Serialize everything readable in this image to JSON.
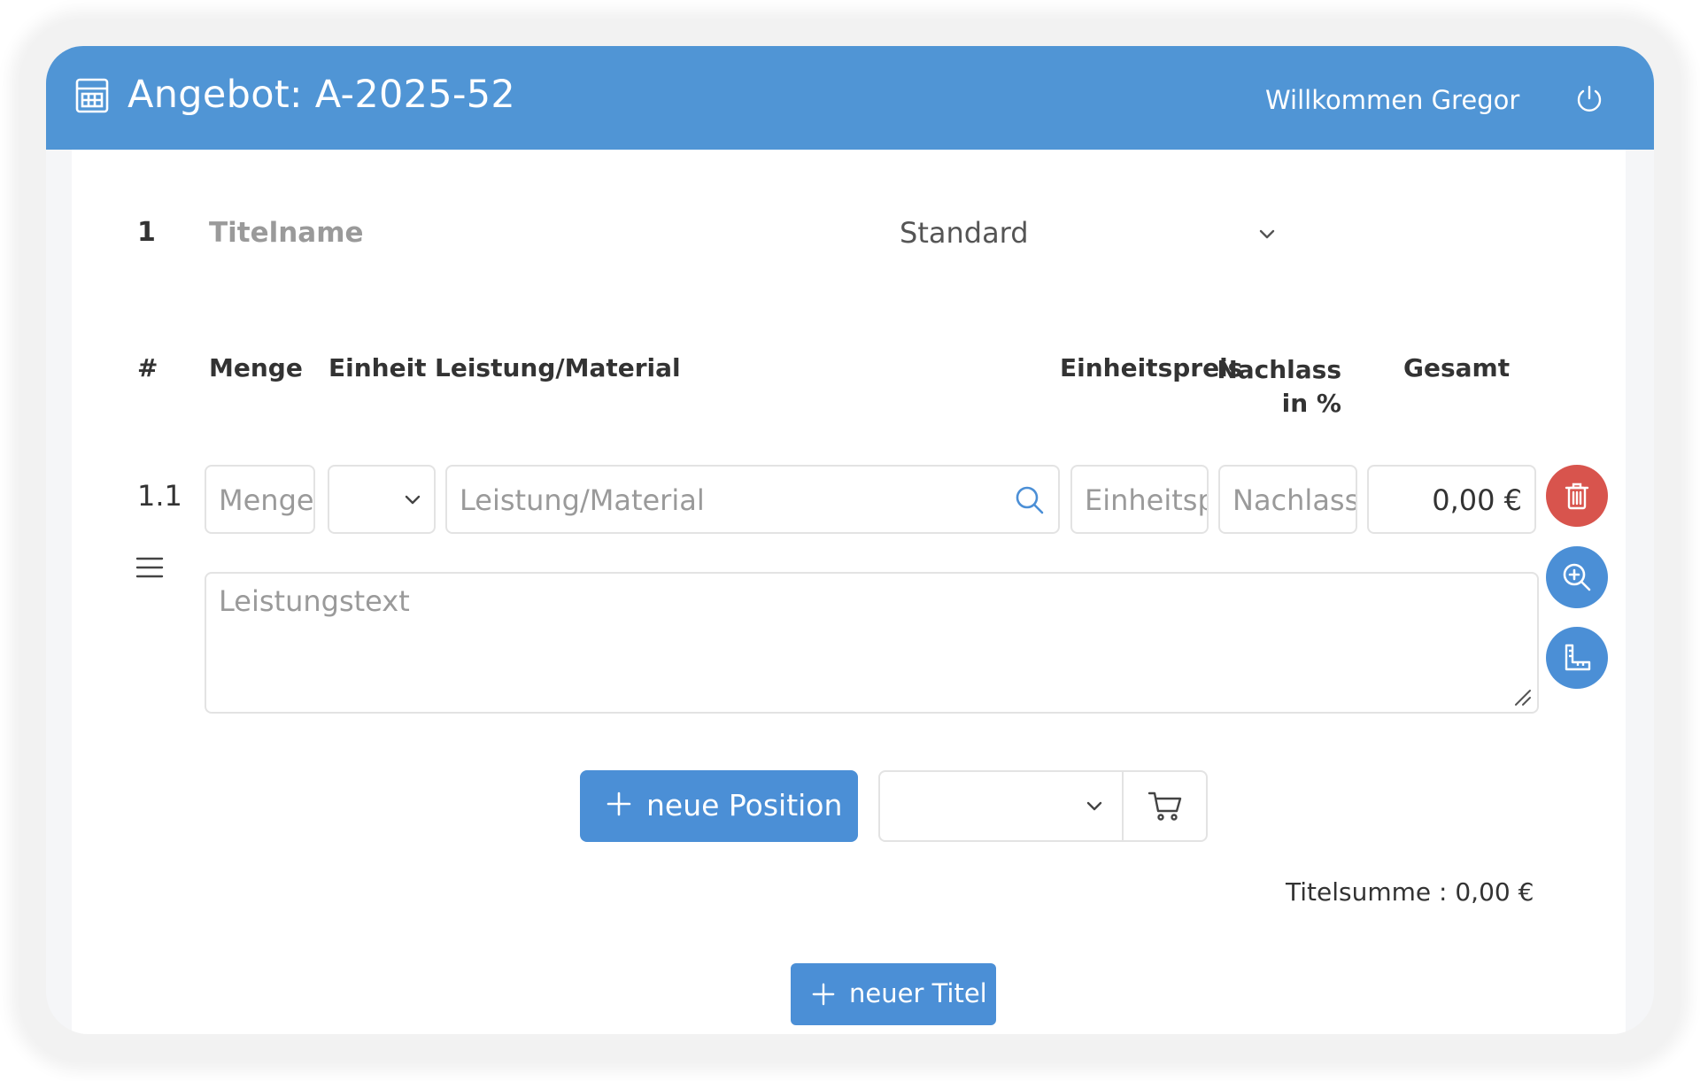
{
  "header": {
    "title": "Angebot: A-2025-52",
    "welcome": "Willkommen Gregor",
    "app_icon": "calculator-icon",
    "power_icon": "power-icon",
    "background_color": "#5095d5"
  },
  "section": {
    "number": "1",
    "name_placeholder": "Titelname",
    "type_select": "Standard"
  },
  "table": {
    "headers": {
      "hash": "#",
      "menge": "Menge",
      "einheit": "Einheit",
      "leistung": "Leistung/Material",
      "einheitspreis": "Einheitspreis",
      "nachlass_line1": "Nachlass",
      "nachlass_line2": "in %",
      "gesamt": "Gesamt"
    },
    "rows": [
      {
        "number": "1.1",
        "menge_placeholder": "Menge",
        "einheit_value": "",
        "leistung_placeholder": "Leistung/Material",
        "einheitspreis_placeholder": "Einheitspreis",
        "nachlass_placeholder": "Nachlass",
        "gesamt_value": "0,00 €",
        "leistungstext_placeholder": "Leistungstext"
      }
    ]
  },
  "actions": {
    "new_position_label": "neue Position",
    "catalog_select_value": "",
    "titlesum_label": "Titelsumme : 0,00 €",
    "new_title_label": "neuer Titel"
  },
  "colors": {
    "primary": "#4b8fd6",
    "danger": "#d8544d"
  }
}
